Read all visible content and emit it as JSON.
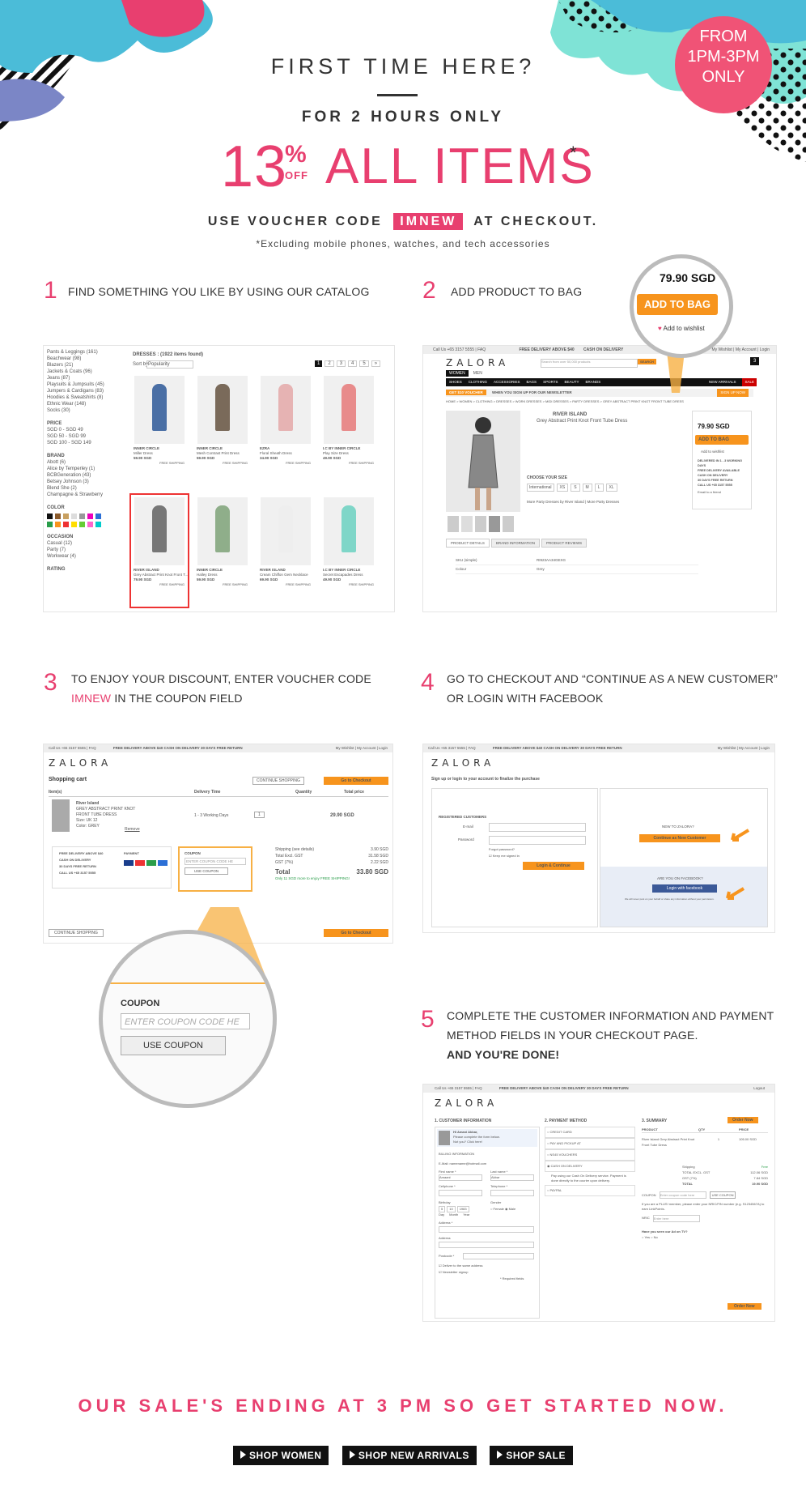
{
  "header": {
    "title": "FIRST TIME HERE?",
    "subtitle": "FOR 2 HOURS ONLY",
    "discount_number": "13",
    "discount_percent": "%",
    "discount_off": "OFF",
    "discount_items": "ALL ITEMS",
    "asterisk": "*",
    "voucher_prefix": "USE VOUCHER CODE",
    "voucher_code": "IMNEW",
    "voucher_suffix": "AT CHECKOUT.",
    "exclusion": "*Excluding mobile phones, watches, and tech accessories"
  },
  "badge": {
    "line1": "FROM",
    "line2": "1PM-3PM",
    "line3": "ONLY"
  },
  "colors": {
    "accent": "#e83f6f",
    "orange": "#f7941d",
    "teal": "#7fe3d6",
    "blue": "#4a8fd6"
  },
  "steps": [
    {
      "num": "1",
      "text": "FIND SOMETHING YOU LIKE BY USING OUR CATALOG"
    },
    {
      "num": "2",
      "text": "ADD PRODUCT TO BAG"
    },
    {
      "num": "3",
      "text_a": "TO ENJOY YOUR DISCOUNT, ENTER VOUCHER CODE",
      "code": "IMNEW",
      "text_b": "IN THE COUPON FIELD"
    },
    {
      "num": "4",
      "text_a": "GO TO CHECKOUT AND “CONTINUE AS A NEW CUSTOMER”",
      "text_b": "OR LOGIN WITH FACEBOOK"
    },
    {
      "num": "5",
      "text_a": "COMPLETE THE CUSTOMER INFORMATION AND PAYMENT",
      "text_b": "METHOD FIELDS IN YOUR CHECKOUT PAGE.",
      "text_c": "AND YOU'RE DONE!"
    }
  ],
  "shot1": {
    "heading": "DRESSES : (1922 items found)",
    "sort": "Sort by",
    "sort_value": "Popularity",
    "filters": [
      "PRICE",
      "BRAND",
      "COLOR",
      "OCCASION",
      "RATING"
    ],
    "price_items": [
      "SGD 0 - SGD 49",
      "SGD 50 - SGD 99",
      "SGD 100 - SGD 149"
    ],
    "brand_items": [
      "Abott (6)",
      "Alice by Temperley (1)",
      "BCBGeneration (43)",
      "Betsey Johnson (3)",
      "Blend She (2)",
      "Champagne & Strawberry"
    ],
    "occasion_items": [
      "Casual (12)",
      "Party (7)",
      "Workwear (4)"
    ],
    "category_items": [
      "Pants & Leggings (161)",
      "Beachwear (98)",
      "Blazers (21)",
      "Jackets & Coats (96)",
      "Jeans (87)",
      "Playsuits & Jumpsuits (45)",
      "Jumpers & Cardigans (83)",
      "Hoodies & Sweatshirts (8)",
      "Ethnic Wear (148)",
      "Socks (30)"
    ],
    "products": [
      {
        "brand": "INNER CIRCLE",
        "name": "Miller Dress",
        "price": "59.90 SGD"
      },
      {
        "brand": "INNER CIRCLE",
        "name": "Mesh Contrast Print Dress",
        "price": "59.90 SGD"
      },
      {
        "brand": "EZRA",
        "name": "Floral Sheath Dress",
        "price": "34.90 SGD"
      },
      {
        "brand": "I.C BY INNER CIRCLE",
        "name": "Play Size Dress",
        "price": "49.90 SGD"
      },
      {
        "brand": "RIVER ISLAND",
        "name": "Grey Abstract Print Knot Front T...",
        "price": "79.90 SGD"
      },
      {
        "brand": "INNER CIRCLE",
        "name": "Halley Dress",
        "price": "59.90 SGD"
      },
      {
        "brand": "RIVER ISLAND",
        "name": "Cream Chiffon Gem Necklace",
        "price": "69.90 SGD"
      },
      {
        "brand": "I.C BY INNER CIRCLE",
        "name": "Secret Escapades Dress",
        "price": "49.90 SGD"
      }
    ],
    "free_shipping": "FREE SHIPPING",
    "pages": [
      "1",
      "2",
      "3",
      "4",
      "5",
      "»"
    ]
  },
  "shot2": {
    "topbar": "Call Us +65 3157 5555 | FAQ",
    "topbar_free": "FREE DELIVERY ABOVE $40",
    "topbar_cod": "CASH ON DELIVERY",
    "topbar_right": "My Wishlist | My Account | Login",
    "logo": "ZALORA",
    "search_placeholder": "Search from over 50,000 products",
    "search_btn": "SEARCH",
    "bag_count": "3",
    "women": "WOMEN",
    "men": "MEN",
    "nav": [
      "SHOES",
      "CLOTHING",
      "ACCESSORIES",
      "BAGS",
      "SPORTS",
      "BEAUTY",
      "BRANDS"
    ],
    "new_arrivals": "NEW ARRIVALS",
    "sale": "SALE",
    "voucher_bar": "GET $10 VOUCHER",
    "voucher_text": "WHEN YOU SIGN UP FOR OUR NEWSLETTER",
    "sign_up": "SIGN UP NOW",
    "breadcrumb": "HOME > WOMEN > CLOTHING > DRESSES > WORK DRESSES > MIDI DRESSES > PARTY DRESSES > GREY ABSTRACT PRINT KNOT FRONT TUBE DRESS",
    "product_brand": "RIVER ISLAND",
    "product_name": "Grey Abstract Print Knot Front Tube Dress",
    "size_label": "CHOOSE YOUR SIZE",
    "size_system": "International",
    "sizes": [
      "XS",
      "S",
      "M",
      "L",
      "XL"
    ],
    "price": "79.90 SGD",
    "add_to_bag": "ADD TO BAG",
    "add_to_wishlist": "Add to wishlist",
    "benefits": [
      "DELIVERED IN 1 - 3 WORKING DAYS",
      "FREE DELIVERY AVAILABLE",
      "CASH ON DELIVERY",
      "30 DAYS FREE RETURN",
      "CALL US +65 3157 5555"
    ],
    "email_friend": "Email to a friend",
    "more": "More Party Dresses by River Island | More Party Dresses",
    "tabs": [
      "PRODUCT DETAILS",
      "BRAND INFORMATION",
      "PRODUCT REVIEWS"
    ],
    "details": [
      [
        "SKU (simple)",
        "RI923AA34GEXG"
      ],
      [
        "Colour",
        "Grey"
      ]
    ],
    "zoom_price": "79.90 SGD",
    "zoom_add": "ADD TO BAG",
    "zoom_wishlist": "Add to wishlist"
  },
  "shot3": {
    "topbar": "Call Us +65 3157 5555 | FAQ",
    "topbar_mid": "FREE DELIVERY ABOVE $40     CASH ON DELIVERY     30 DAYS FREE RETURN",
    "topbar_right": "My Wishlist | My Account | Login",
    "logo": "ZALORA",
    "title": "Shopping cart",
    "continue": "CONTINUE SHOPPING",
    "checkout": "Go to Checkout",
    "headers": [
      "Item(s)",
      "Delivery Time",
      "Quantity",
      "Total price"
    ],
    "item_brand": "River Island",
    "item_name": "GREY ABSTRACT PRINT KNOT FRONT TUBE DRESS",
    "item_size": "Size: UK 12",
    "item_color": "Color: GREY",
    "remove": "Remove",
    "delivery": "1 - 3 Working Days",
    "qty": "1",
    "item_total": "29.90 SGD",
    "perks": [
      "FREE DELIVERY ABOVE $40",
      "CASH ON DELIVERY",
      "30 DAYS FREE RETURN",
      "CALL US +65 3157 5555"
    ],
    "payment": "PAYMENT",
    "coupon": "COUPON",
    "coupon_placeholder": "ENTER COUPON CODE HE",
    "use_coupon": "USE COUPON",
    "shipping_label": "Shipping (see details)",
    "shipping_value": "3.90 SGD",
    "excl_label": "Total Excl. GST",
    "excl_value": "31.58 SGD",
    "gst_label": "GST (7%)",
    "gst_value": "2.22 SGD",
    "total_label": "Total",
    "total_value": "33.80 SGD",
    "free_note": "Only 11 SGD more to enjoy FREE SHIPPING!",
    "zoom_coupon": "COUPON",
    "zoom_placeholder": "ENTER COUPON CODE HE",
    "zoom_button": "USE COUPON"
  },
  "shot4": {
    "topbar": "Call Us +65 3157 5555 | FAQ",
    "topbar_mid": "FREE DELIVERY ABOVE $40     CASH ON DELIVERY     30 DAYS FREE RETURN",
    "topbar_right": "My Wishlist | My Account | Login",
    "logo": "ZALORA",
    "heading": "Sign up or login to your account to finalize the purchase",
    "registered": "REGISTERED CUSTOMERS",
    "email": "E-mail",
    "password": "Password",
    "forgot": "Forgot password?",
    "keep": "Keep me signed in",
    "login_btn": "Login & Continue",
    "new_label": "NEW TO ZALORA?",
    "new_btn": "Continue as New Customer",
    "fb_label": "ARE YOU ON FACEBOOK?",
    "fb_btn": "Login with facebook",
    "fb_note": "We will never post on your behalf or share any information without your permission."
  },
  "shot5": {
    "topbar": "Call Us +65 3157 5555 | FAQ",
    "topbar_mid": "FREE DELIVERY ABOVE $40     CASH ON DELIVERY     30 DAYS FREE RETURN",
    "topbar_right": "Logout",
    "logo": "ZALORA",
    "col1": "1. CUSTOMER INFORMATION",
    "col2": "2. PAYMENT METHOD",
    "col3": "3. SUMMARY",
    "order_now": "Order Now",
    "hi": "Hi Amani Akbar,",
    "complete": "Please complete the form below.",
    "notyou": "Not you? Click here!",
    "billing": "BILLING INFORMATION",
    "emailline": "E-Mail: namename@hotmail.com",
    "first_name": "First name *",
    "first_value": "Amaani",
    "last_name": "Last name *",
    "last_value": "Akbar",
    "cellphone": "Cellphone *",
    "telephone": "Telephone *",
    "birthday": "Birthday",
    "bday": [
      "5",
      "10",
      "1983"
    ],
    "bday_labels": [
      "Day",
      "Month",
      "Year"
    ],
    "gender": "Gender",
    "female": "Female",
    "male": "Male",
    "address": "Address *",
    "address2": "Address",
    "postcode": "Postcode *",
    "same": "Deliver to the same address",
    "newsletter": "Newsletter signup",
    "required": "* Required fields",
    "methods": [
      "CREDIT CARD",
      "PAY AND PICKUP AT",
      "NS45 VOUCHERS",
      "CASH ON DELIVERY",
      "PAYPAL"
    ],
    "cod_note": "Pay using our Cash On Delivery service. Payment is done directly to the courier upon delivery.",
    "sum_headers": [
      "PRODUCT",
      "QTY",
      "PRICE"
    ],
    "sum_product": "River Island Grey Abstract Print Knot Front Tube Dress",
    "sum_qty": "1",
    "sum_price": "105.00 SGD",
    "shipping": "Shipping",
    "shipping_value": "Free",
    "excl": "TOTAL EXCL. GST",
    "excl_value": "112.06 SGD",
    "gst": "GST (7%)",
    "gst_value": "7.84 SGD",
    "total": "TOTAL",
    "total_value": "19.90 SGD",
    "coupon": "COUPON",
    "coupon_placeholder": "Enter coupon code here",
    "use_coupon": "USE COUPON",
    "plus_note": "If you are a PLUS! member, please enter your NRIC/FIN number (e.g. S1234567A) to earn LinkPoints.",
    "nric": "NRIC",
    "nric_placeholder": "Enter here",
    "tv": "Have you seen our Ad on TV?",
    "yes": "Yes",
    "no": "No"
  },
  "footer": {
    "cta": "OUR SALE'S ENDING AT 3 PM SO GET STARTED NOW.",
    "buttons": [
      "SHOP WOMEN",
      "SHOP NEW ARRIVALS",
      "SHOP  SALE"
    ]
  }
}
